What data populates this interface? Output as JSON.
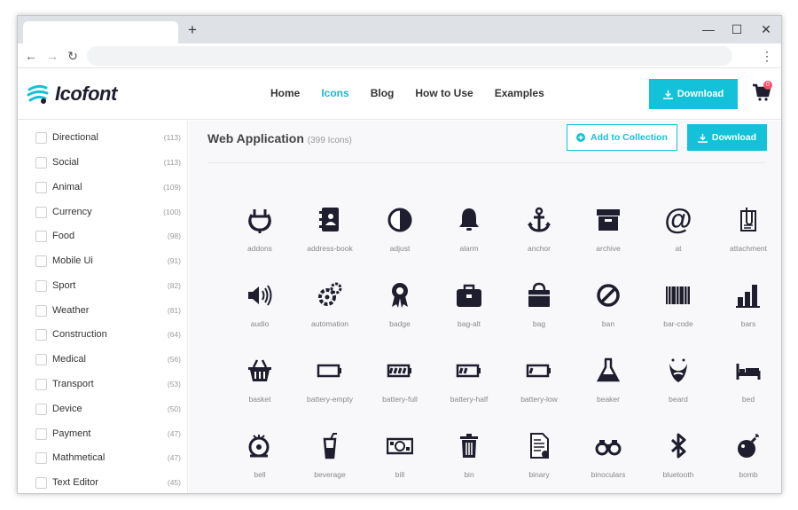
{
  "browser": {
    "new_tab": "+",
    "controls": {
      "minimize": "—",
      "maximize": "☐",
      "close": "✕"
    },
    "nav": {
      "back": "←",
      "forward": "→",
      "reload": "↻",
      "menu": "⋮"
    },
    "address": ""
  },
  "header": {
    "logo_text": "Icofont",
    "nav": [
      "Home",
      "Icons",
      "Blog",
      "How to Use",
      "Examples"
    ],
    "active_nav": "Icons",
    "download_label": "Download",
    "cart_count": "0"
  },
  "sidebar": {
    "categories": [
      {
        "label": "Directional",
        "count": "(113)"
      },
      {
        "label": "Social",
        "count": "(113)"
      },
      {
        "label": "Animal",
        "count": "(109)"
      },
      {
        "label": "Currency",
        "count": "(100)"
      },
      {
        "label": "Food",
        "count": "(98)"
      },
      {
        "label": "Mobile Ui",
        "count": "(91)"
      },
      {
        "label": "Sport",
        "count": "(82)"
      },
      {
        "label": "Weather",
        "count": "(81)"
      },
      {
        "label": "Construction",
        "count": "(64)"
      },
      {
        "label": "Medical",
        "count": "(56)"
      },
      {
        "label": "Transport",
        "count": "(53)"
      },
      {
        "label": "Device",
        "count": "(50)"
      },
      {
        "label": "Payment",
        "count": "(47)"
      },
      {
        "label": "Mathmetical",
        "count": "(47)"
      },
      {
        "label": "Text Editor",
        "count": "(45)"
      }
    ]
  },
  "main": {
    "title": "Web Application",
    "subtitle": "(399 Icons)",
    "add_collection_label": "Add to Collection",
    "download_label": "Download",
    "icons": [
      "addons",
      "address-book",
      "adjust",
      "alarm",
      "anchor",
      "archive",
      "at",
      "attachment",
      "audio",
      "automation",
      "badge",
      "bag-alt",
      "bag",
      "ban",
      "bar-code",
      "bars",
      "basket",
      "battery-empty",
      "battery-full",
      "battery-half",
      "battery-low",
      "beaker",
      "beard",
      "bed",
      "bell",
      "beverage",
      "bill",
      "bin",
      "binary",
      "binoculars",
      "bluetooth",
      "bomb"
    ]
  },
  "colors": {
    "accent": "#13c2d8",
    "icon": "#1e1e2e",
    "badge": "#ff4d67"
  }
}
